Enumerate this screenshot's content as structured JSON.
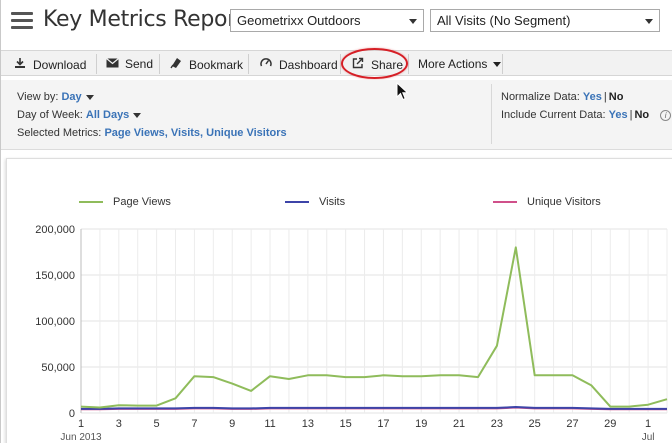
{
  "header": {
    "title": "Key Metrics Report",
    "report_suite": "Geometrixx Outdoors",
    "segment": "All Visits (No Segment)"
  },
  "toolbar": {
    "download": "Download",
    "send": "Send",
    "bookmark": "Bookmark",
    "dashboard": "Dashboard",
    "share": "Share",
    "more_actions": "More Actions"
  },
  "options": {
    "view_by_label": "View by:",
    "view_by_value": "Day",
    "day_of_week_label": "Day of Week:",
    "day_of_week_value": "All Days",
    "selected_metrics_label": "Selected Metrics:",
    "selected_metrics_value": "Page Views, Visits, Unique Visitors",
    "normalize_label": "Normalize Data:",
    "normalize_yes": "Yes",
    "normalize_no": "No",
    "include_current_label": "Include Current Data:",
    "include_current_yes": "Yes",
    "include_current_no": "No"
  },
  "colors": {
    "page_views": "#8fbc5b",
    "visits": "#3d44a8",
    "unique_visitors": "#d0508a",
    "link": "#3a73b7",
    "highlight": "#d61f26"
  },
  "chart_data": {
    "type": "line",
    "x_labels": [
      "1",
      "3",
      "5",
      "7",
      "9",
      "11",
      "13",
      "15",
      "17",
      "19",
      "21",
      "23",
      "25",
      "27",
      "29",
      "1"
    ],
    "x_sublabels": [
      "Jun 2013",
      "Jul"
    ],
    "yticks": [
      "0",
      "50,000",
      "100,000",
      "150,000",
      "200,000"
    ],
    "ylim": [
      0,
      200000
    ],
    "grid": true,
    "legend_position": "top",
    "series": [
      {
        "name": "Page Views",
        "color": "#8fbc5b",
        "values": [
          7000,
          6000,
          8500,
          8000,
          8000,
          16000,
          40000,
          39000,
          32000,
          24000,
          40000,
          37000,
          41000,
          41000,
          39000,
          39000,
          41000,
          40000,
          40000,
          41000,
          41000,
          39000,
          73000,
          180000,
          41000,
          41000,
          41000,
          30000,
          7000,
          7000,
          9000,
          15000
        ]
      },
      {
        "name": "Visits",
        "color": "#3d44a8",
        "values": [
          4500,
          4500,
          5000,
          5000,
          5000,
          5000,
          5500,
          5500,
          5000,
          5000,
          5500,
          5500,
          5500,
          5500,
          5500,
          5500,
          5500,
          5500,
          5500,
          5500,
          5500,
          5500,
          5500,
          6500,
          5500,
          5500,
          5500,
          5000,
          4500,
          4500,
          4500,
          4500
        ]
      },
      {
        "name": "Unique Visitors",
        "color": "#d0508a",
        "values": [
          4000,
          4000,
          4500,
          4500,
          4500,
          4500,
          5000,
          5000,
          4500,
          4500,
          5000,
          5000,
          5000,
          5000,
          5000,
          5000,
          5000,
          5000,
          5000,
          5000,
          5000,
          5000,
          5000,
          6000,
          5000,
          5000,
          5000,
          4500,
          4000,
          4000,
          4000,
          4000
        ]
      }
    ]
  }
}
